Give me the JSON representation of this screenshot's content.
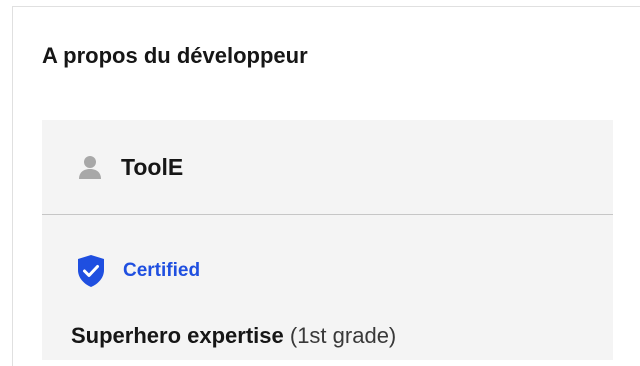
{
  "section": {
    "title": "A propos du développeur"
  },
  "developer": {
    "name": "ToolE",
    "avatar_icon": "user-icon"
  },
  "certification": {
    "label": "Certified",
    "icon": "shield-check-icon",
    "color": "#1f4fe0"
  },
  "expertise": {
    "title": "Superhero expertise",
    "grade": "(1st grade)"
  },
  "colors": {
    "panel_background": "#f4f4f4",
    "divider": "#c6c6c6",
    "text": "#161616",
    "icon_gray": "#a8a8a8"
  }
}
